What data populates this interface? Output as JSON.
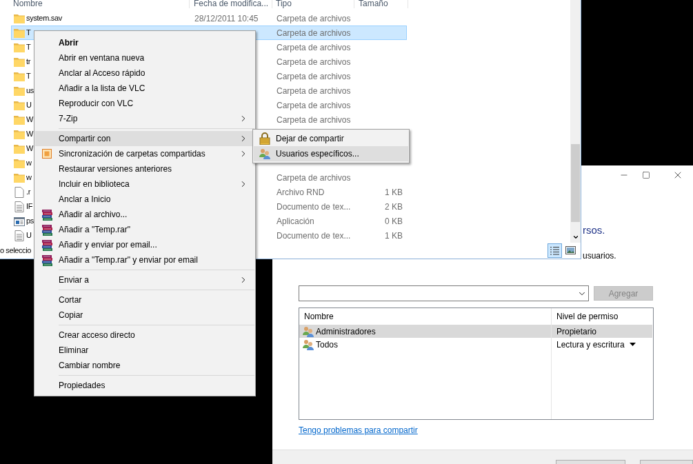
{
  "explorer": {
    "columns": [
      "Nombre",
      "Fecha de modifica...",
      "Tipo",
      "Tamaño"
    ],
    "rows": [
      {
        "name": "system.sav",
        "kind": "folder",
        "date": "28/12/2011 10:45",
        "type": "Carpeta de archivos",
        "selected": false
      },
      {
        "name": "T",
        "kind": "folder",
        "type": "Carpeta de archivos",
        "selected": true
      },
      {
        "name": "T",
        "kind": "folder",
        "type": "Carpeta de archivos",
        "selected": false
      },
      {
        "name": "tr",
        "kind": "folder",
        "type": "Carpeta de archivos",
        "selected": false
      },
      {
        "name": "T",
        "kind": "folder",
        "type": "Carpeta de archivos",
        "selected": false
      },
      {
        "name": "us",
        "kind": "folder",
        "type": "Carpeta de archivos",
        "selected": false
      },
      {
        "name": "U",
        "kind": "folder",
        "type": "Carpeta de archivos",
        "selected": false
      },
      {
        "name": "W",
        "kind": "folder",
        "type": "Carpeta de archivos",
        "selected": false
      },
      {
        "name": "W",
        "kind": "folder",
        "selected": false
      },
      {
        "name": "W",
        "kind": "folder",
        "selected": false
      },
      {
        "name": "w",
        "kind": "folder",
        "selected": false
      },
      {
        "name": "w",
        "kind": "folder",
        "type": "Carpeta de archivos",
        "selected": false
      },
      {
        "name": ".r",
        "kind": "file",
        "type": "Archivo RND",
        "size": "1 KB",
        "selected": false
      },
      {
        "name": "IF",
        "kind": "text",
        "type": "Documento de tex...",
        "size": "2 KB",
        "selected": false
      },
      {
        "name": "ps",
        "kind": "app",
        "type": "Aplicación",
        "size": "0 KB",
        "selected": false
      },
      {
        "name": "U",
        "kind": "text",
        "type": "Documento de tex...",
        "size": "1 KB",
        "selected": false
      }
    ],
    "status": "o seleccio",
    "view_buttons": [
      {
        "kind": "details",
        "selected": true
      },
      {
        "kind": "tiles",
        "selected": false
      }
    ]
  },
  "context_menu": {
    "items": [
      {
        "kind": "plain",
        "label": "Abrir",
        "default": true,
        "submenu": false,
        "selected": false
      },
      {
        "kind": "plain",
        "label": "Abrir en ventana nueva",
        "default": false,
        "submenu": false,
        "selected": false
      },
      {
        "kind": "plain",
        "label": "Anclar al Acceso rápido",
        "default": false,
        "submenu": false,
        "selected": false
      },
      {
        "kind": "plain",
        "label": "Añadir a la lista de VLC",
        "default": false,
        "submenu": false,
        "selected": false
      },
      {
        "kind": "plain",
        "label": "Reproducir con VLC",
        "default": false,
        "submenu": false,
        "selected": false
      },
      {
        "kind": "plain",
        "label": "7-Zip",
        "default": false,
        "submenu": true,
        "selected": false
      },
      {
        "kind": "separator"
      },
      {
        "kind": "plain",
        "label": "Compartir con",
        "default": false,
        "submenu": true,
        "selected": true
      },
      {
        "kind": "sync",
        "label": "Sincronización de carpetas compartidas",
        "default": false,
        "submenu": true,
        "selected": false
      },
      {
        "kind": "plain",
        "label": "Restaurar versiones anteriores",
        "default": false,
        "submenu": false,
        "selected": false
      },
      {
        "kind": "plain",
        "label": "Incluir en biblioteca",
        "default": false,
        "submenu": true,
        "selected": false
      },
      {
        "kind": "plain",
        "label": "Anclar a Inicio",
        "default": false,
        "submenu": false,
        "selected": false
      },
      {
        "kind": "archive",
        "label": "Añadir al archivo...",
        "default": false,
        "submenu": false,
        "selected": false
      },
      {
        "kind": "archive",
        "label": "Añadir a \"Temp.rar\"",
        "default": false,
        "submenu": false,
        "selected": false
      },
      {
        "kind": "archive",
        "label": "Añadir y enviar por email...",
        "default": false,
        "submenu": false,
        "selected": false
      },
      {
        "kind": "archive",
        "label": "Añadir a \"Temp.rar\" y enviar por email",
        "default": false,
        "submenu": false,
        "selected": false
      },
      {
        "kind": "separator"
      },
      {
        "kind": "plain",
        "label": "Enviar a",
        "default": false,
        "submenu": true,
        "selected": false
      },
      {
        "kind": "separator"
      },
      {
        "kind": "plain",
        "label": "Cortar",
        "default": false,
        "submenu": false,
        "selected": false
      },
      {
        "kind": "plain",
        "label": "Copiar",
        "default": false,
        "submenu": false,
        "selected": false
      },
      {
        "kind": "separator"
      },
      {
        "kind": "plain",
        "label": "Crear acceso directo",
        "default": false,
        "submenu": false,
        "selected": false
      },
      {
        "kind": "plain",
        "label": "Eliminar",
        "default": false,
        "submenu": false,
        "selected": false
      },
      {
        "kind": "plain",
        "label": "Cambiar nombre",
        "default": false,
        "submenu": false,
        "selected": false
      },
      {
        "kind": "separator"
      },
      {
        "kind": "plain",
        "label": "Propiedades",
        "default": false,
        "submenu": false,
        "selected": false
      }
    ]
  },
  "submenu": {
    "items": [
      {
        "kind": "lock",
        "label": "Dejar de compartir",
        "selected": false
      },
      {
        "kind": "users",
        "label": "Usuarios específicos...",
        "selected": true
      }
    ]
  },
  "dialog": {
    "heading": "rsos.",
    "text": "usuarios.",
    "add_button": {
      "label": "Agregar",
      "disabled": true
    },
    "list": {
      "columns": [
        "Nombre",
        "Nivel de permiso"
      ],
      "rows": [
        {
          "name": "Administradores",
          "permission": "Propietario",
          "dropdown": false,
          "selected": true
        },
        {
          "name": "Todos",
          "permission": "Lectura y escritura",
          "dropdown": true,
          "selected": false
        }
      ]
    },
    "link": "Tengo problemas para compartir"
  }
}
